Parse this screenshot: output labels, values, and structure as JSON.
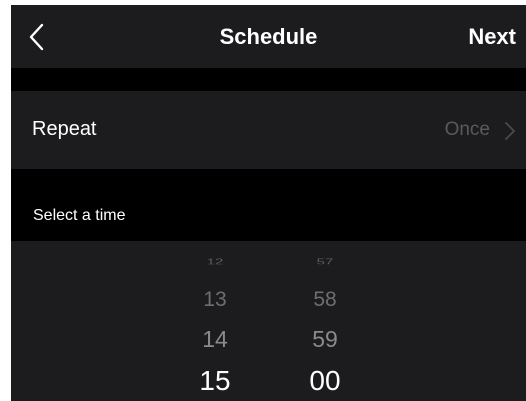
{
  "nav": {
    "title": "Schedule",
    "next_label": "Next",
    "back_icon": "chevron-left-icon"
  },
  "repeat": {
    "label": "Repeat",
    "value": "Once",
    "chevron_icon": "chevron-right-icon"
  },
  "section": {
    "label": "Select a time"
  },
  "picker": {
    "hours": [
      "12",
      "13",
      "14",
      "15"
    ],
    "minutes": [
      "57",
      "58",
      "59",
      "00"
    ],
    "selected_hour": "15",
    "selected_minute": "00"
  },
  "colors": {
    "background": "#000000",
    "surface": "#1c1c1e",
    "text": "#ffffff",
    "secondary_text": "#5a5a5e"
  }
}
